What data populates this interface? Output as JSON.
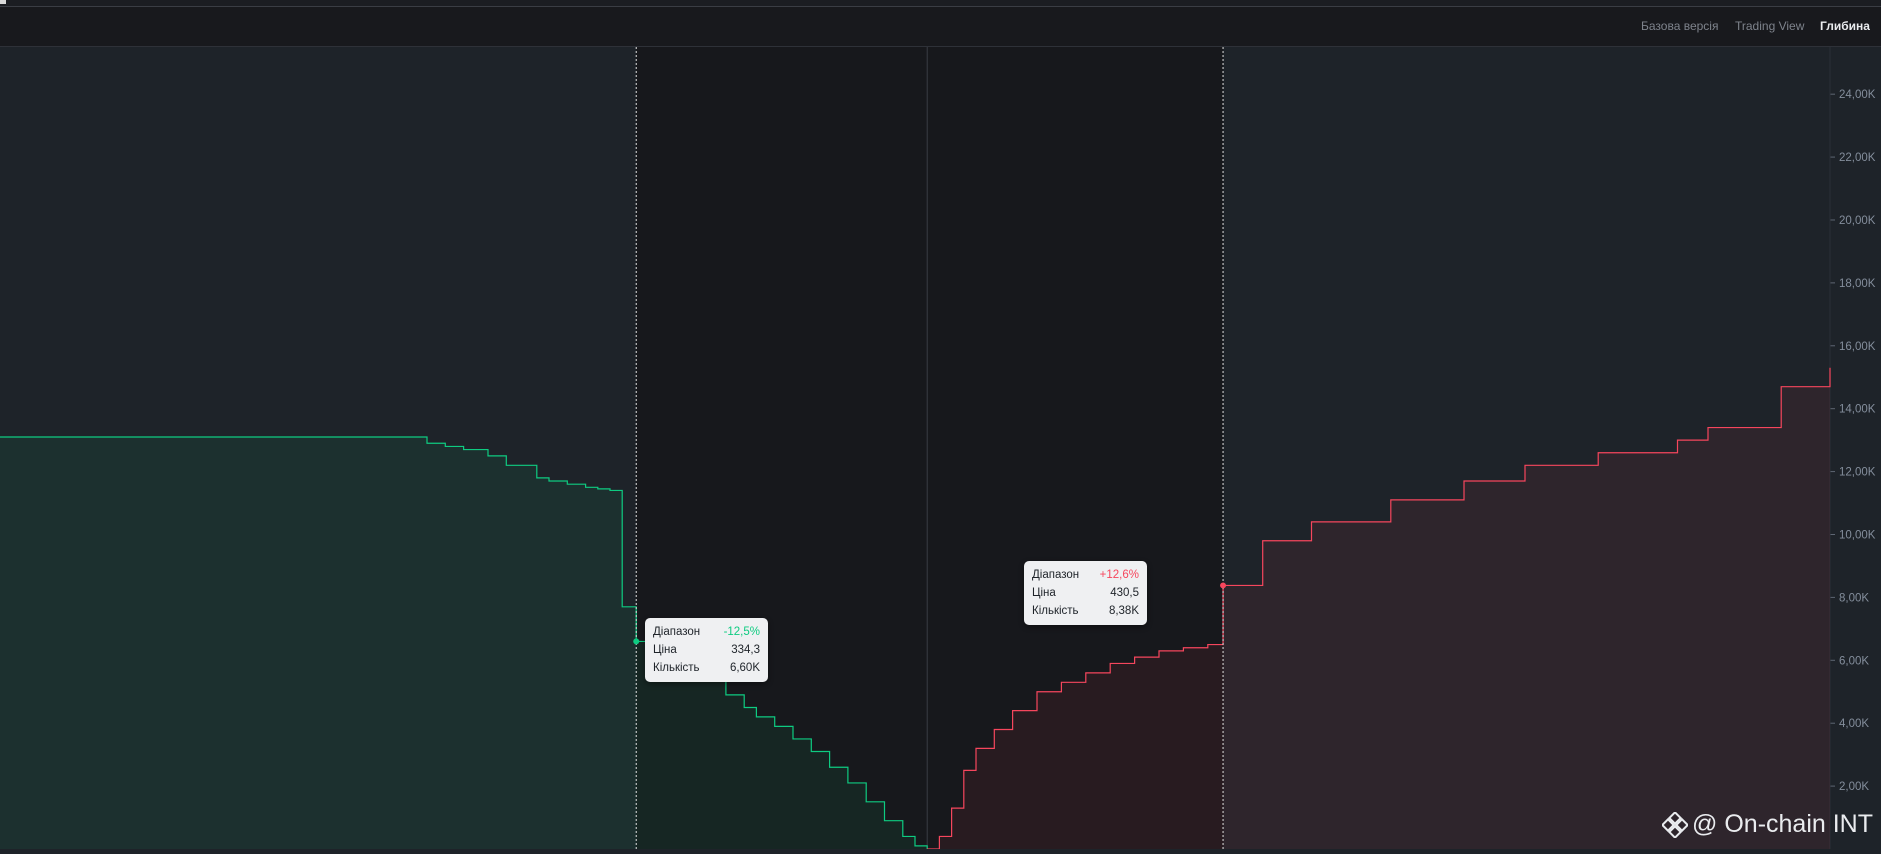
{
  "tabs": [
    {
      "label": "Базова версія",
      "active": false
    },
    {
      "label": "Trading View",
      "active": false
    },
    {
      "label": "Глибина",
      "active": true
    }
  ],
  "colors": {
    "bid": "#0ecb81",
    "ask": "#f6465d",
    "background": "#1e2329",
    "range_shade": "#17181c"
  },
  "tooltips": {
    "bid": {
      "range_label": "Діапазон",
      "range_value": "-12,5%",
      "price_label": "Ціна",
      "price_value": "334,3",
      "qty_label": "Кількість",
      "qty_value": "6,60K"
    },
    "ask": {
      "range_label": "Діапазон",
      "range_value": "+12,6%",
      "price_label": "Ціна",
      "price_value": "430,5",
      "qty_label": "Кількість",
      "qty_value": "8,38K"
    }
  },
  "watermark": {
    "text": "@ On-chain INT",
    "icon": "binance-logo-icon"
  },
  "chart_data": {
    "type": "area",
    "y_ticks": [
      "2,00K",
      "4,00K",
      "6,00K",
      "8,00K",
      "10,00K",
      "12,00K",
      "14,00K",
      "16,00K",
      "18,00K",
      "20,00K",
      "22,00K",
      "24,00K"
    ],
    "ylim": [
      0,
      25500
    ],
    "xlim": [
      230,
      530
    ],
    "mid_price": 382,
    "range_lower": 334.3,
    "range_upper": 430.5,
    "series": [
      {
        "name": "bids",
        "x": [
          230,
          283,
          300,
          301,
          303,
          306,
          310,
          313,
          318,
          320,
          323,
          326,
          328,
          330,
          332,
          334.3,
          336,
          339,
          342,
          345,
          349,
          352,
          354,
          357,
          360,
          363,
          366,
          369,
          372,
          375,
          378,
          380,
          382
        ],
        "y": [
          13100,
          13100,
          12900,
          12900,
          12800,
          12700,
          12500,
          12200,
          11800,
          11700,
          11600,
          11500,
          11450,
          11400,
          7700,
          6600,
          6500,
          6200,
          5900,
          5400,
          4900,
          4500,
          4200,
          3900,
          3500,
          3100,
          2600,
          2100,
          1500,
          900,
          400,
          100,
          0
        ]
      },
      {
        "name": "asks",
        "x": [
          382,
          384,
          386,
          388,
          390,
          393,
          396,
          400,
          404,
          408,
          412,
          416,
          420,
          424,
          428,
          430.5,
          437,
          445,
          458,
          470,
          480,
          492,
          505,
          510,
          522,
          530
        ],
        "y": [
          0,
          400,
          1300,
          2500,
          3200,
          3800,
          4400,
          5000,
          5300,
          5600,
          5900,
          6100,
          6300,
          6400,
          6500,
          8380,
          9800,
          10400,
          11100,
          11700,
          12200,
          12600,
          13000,
          13400,
          14700,
          15300
        ]
      }
    ]
  }
}
